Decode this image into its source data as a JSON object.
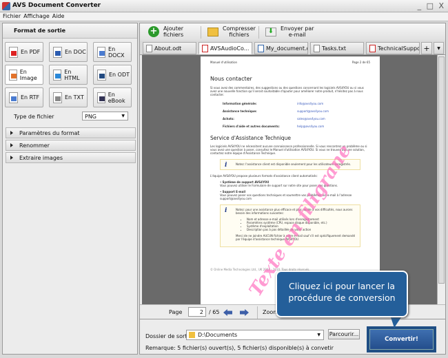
{
  "window": {
    "title": "AVS Document Converter",
    "controls": "_ □ X"
  },
  "menu": [
    "Fichier",
    "Affichage",
    "Aide"
  ],
  "left": {
    "header": "Format de sortie",
    "formats": [
      {
        "label": "En PDF",
        "color": "#d22"
      },
      {
        "label": "En DOC",
        "color": "#2a5bb0"
      },
      {
        "label": "En DOCX",
        "color": "#4a7bd0"
      },
      {
        "label": "En Image",
        "color": "#e2722a"
      },
      {
        "label": "En HTML",
        "color": "#2a88d8"
      },
      {
        "label": "En ODT",
        "color": "#224a80"
      },
      {
        "label": "En RTF",
        "color": "#4a7bd0"
      },
      {
        "label": "En TXT",
        "color": "#888"
      },
      {
        "label": "En eBook",
        "color": "#335"
      }
    ],
    "selected": "En Image",
    "file_type_label": "Type de fichier",
    "file_type_value": "PNG",
    "sections": [
      "Paramètres du format",
      "Renommer",
      "Extraire images"
    ]
  },
  "toolbar": {
    "add": "Ajouter\nfichiers",
    "compress": "Compresser\nfichiers",
    "email": "Envoyer par\ne-mail"
  },
  "tabs": [
    "About.odt",
    "AVSAudioCo...",
    "My_document.doc",
    "Tasks.txt",
    "TechnicalSuppor..."
  ],
  "document": {
    "header_left": "Manuel d'utilisation",
    "header_right": "Page 2 de 65",
    "h1": "Nous contacter",
    "intro": "Si vous avez des commentaires, des suggestions ou des questions concernant les logiciels AVS4YOU ou si vous avez une nouvelle fonction qu'il serait souhaitable d'ajouter pour améliorer notre produit, n'hésitez pas à nous contacter.",
    "contacts": [
      {
        "label": "Information générale:",
        "value": "info@avs4you.com"
      },
      {
        "label": "Assistance technique:",
        "value": "support@avs4you.com"
      },
      {
        "label": "Achats:",
        "value": "sales@avs4you.com"
      },
      {
        "label": "Fichiers d'aide et autres documents:",
        "value": "help@avs4you.com"
      }
    ],
    "h2": "Service d'Assistance Technique",
    "p2": "Les logiciels AVS4YOU ne nécessitent aucune connaissance professionnelle. Si vous rencontrez un problème ou si vous avez une question à poser, consultez le Manuel d'utilisation AVS4YOU. Si vous ne trouvez aucune solution, contactez notre équipe d'Assistance Technique.",
    "note1": "Notez: l'assistance client est disponible seulement pour les utilisateurs enregistrés.",
    "p3": "L'équipe AVS4YOU propose plusieurs formats d'assistance client automatisés:",
    "b1_title": "Système de support AVS4YOU",
    "b1_text": "Vous pouvez utiliser le Formulaire de support sur notre site pour poser vos questions.",
    "b2_title": "Support E-mail",
    "b2_text": "Vous pouvez poser vos questions techniques et soumettre vos problèmes via e-mail à l'adresse support@avs4you.com",
    "note2": "Notez: pour une assistance plus efficace et plus rapide à vos difficultés, nous aurons besoin des informations suivantes:",
    "note2_items": [
      "Nom et adresse e-mail utilisés lors d'enregistrement",
      "Paramètres système (CPU, espace disque disponible, etc.)",
      "Système d'exploitation",
      "Description pas à pas détaillée de votre action"
    ],
    "note2_end": "Merci de ne joindre AUCUN fichier à votre e-mail sauf s'il est spécifiquement demandé par l'équipe d'assistance technique AVS4YOU.",
    "footer": "© Online Media Technologies Ltd., UK 2004 - 2010. Tous droits réservés.",
    "watermark": "Texte en filigrane"
  },
  "pagenav": {
    "page_label": "Page",
    "page": "2",
    "total": "/ 65",
    "zoom_label": "Zoom"
  },
  "bottom": {
    "folder_label": "Dossier de sortie:",
    "folder": "D:\\Documents",
    "browse": "Parcourir...",
    "remark": "Remarque: 5 fichier(s) ouvert(s), 5 fichier(s) disponible(s) à convetir",
    "convert": "Convertir!"
  },
  "callout": "Cliquez ici pour lancer la procédure de conversion"
}
